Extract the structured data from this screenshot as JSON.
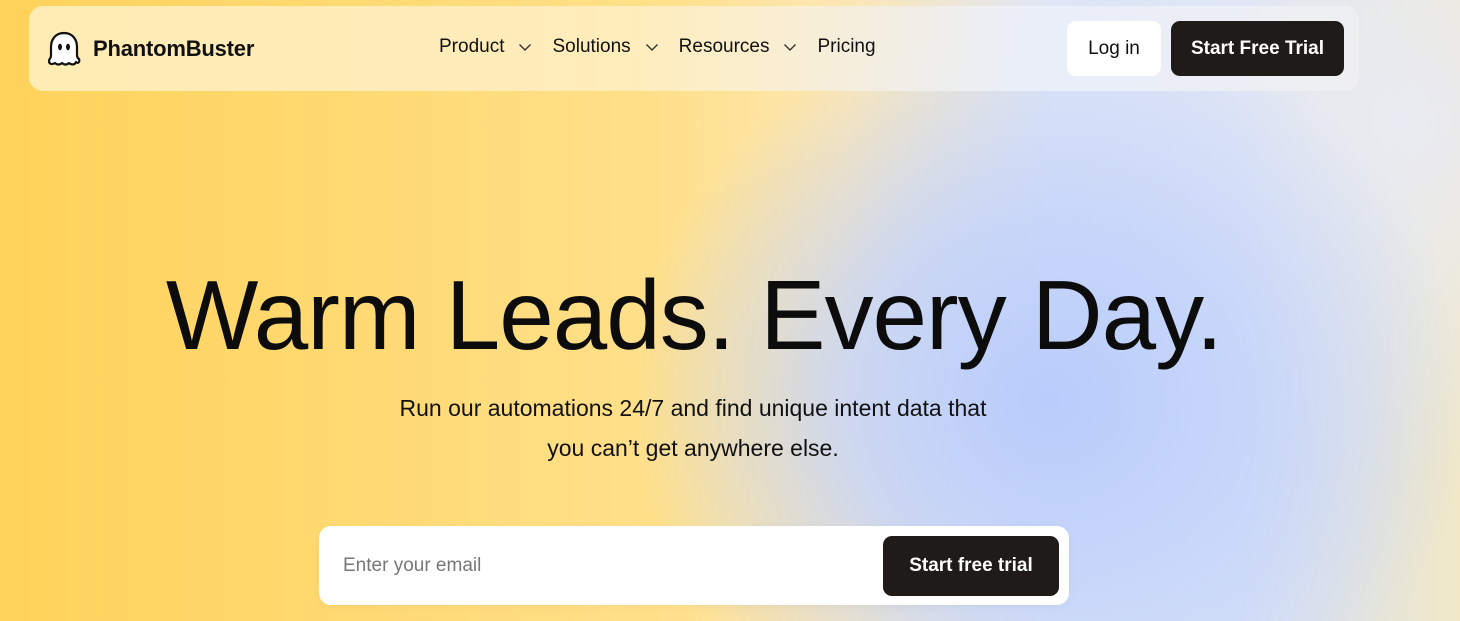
{
  "brand": {
    "name": "PhantomBuster",
    "logo_icon": "ghost-icon"
  },
  "nav": {
    "items": [
      {
        "label": "Product",
        "has_dropdown": true
      },
      {
        "label": "Solutions",
        "has_dropdown": true
      },
      {
        "label": "Resources",
        "has_dropdown": true
      },
      {
        "label": "Pricing",
        "has_dropdown": false
      }
    ],
    "login_label": "Log in",
    "trial_label": "Start Free Trial"
  },
  "hero": {
    "title": "Warm Leads. Every Day.",
    "subtitle_line1": "Run our automations 24/7 and find unique intent data that",
    "subtitle_line2": "you can’t get anywhere else."
  },
  "signup": {
    "email_value": "",
    "email_placeholder": "Enter your email",
    "button_label": "Start free trial"
  },
  "colors": {
    "dark_button": "#1f1b18",
    "yellow": "#ffd25a",
    "blue": "#b9ccfb"
  }
}
